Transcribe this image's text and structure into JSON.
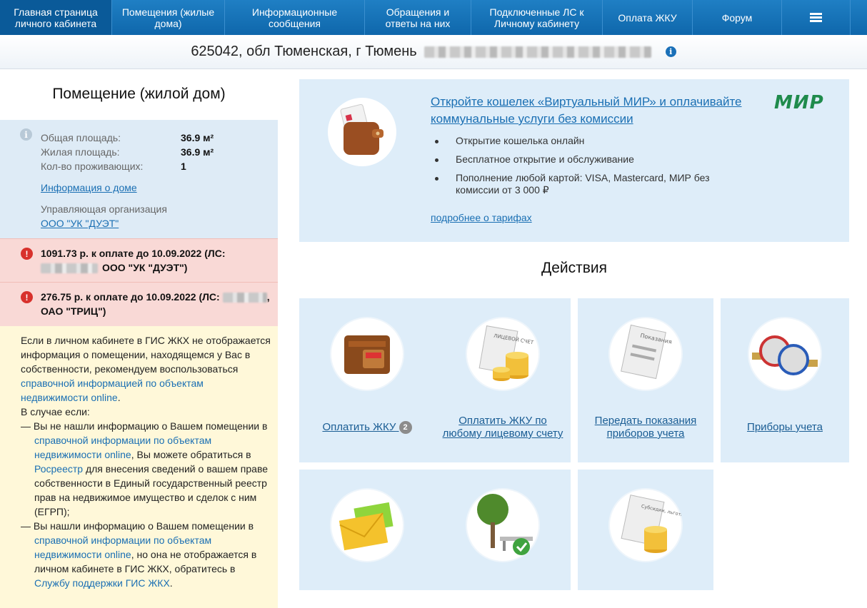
{
  "nav": {
    "items": [
      {
        "label": "Главная страница личного кабинета"
      },
      {
        "label": "Помещения (жилые дома)"
      },
      {
        "label": "Информационные сообщения"
      },
      {
        "label": "Обращения и ответы на них"
      },
      {
        "label": "Подключенные ЛС к Личному кабинету"
      },
      {
        "label": "Оплата ЖКУ"
      },
      {
        "label": "Форум"
      }
    ],
    "menu_icon": "hamburger-icon"
  },
  "address": {
    "text": "625042, обл Тюменская, г Тюмень"
  },
  "left": {
    "title": "Помещение (жилой дом)",
    "info": {
      "total_area_label": "Общая площадь:",
      "total_area_value": "36.9 м²",
      "living_area_label": "Жилая площадь:",
      "living_area_value": "36.9 м²",
      "residents_label": "Кол-во проживающих:",
      "residents_value": "1",
      "house_info_link": "Информация о доме",
      "management_label": "Управляющая организация",
      "management_link": "ООО \"УК \"ДУЭТ\""
    },
    "alerts": [
      {
        "line1": "1091.73 р. к оплате до 10.09.2022 (ЛС:",
        "line2": "ООО \"УК \"ДУЭТ\")"
      },
      {
        "line1": "276.75 р. к оплате до 10.09.2022 (ЛС:",
        "line2": "ОАО \"ТРИЦ\")"
      }
    ],
    "note": {
      "p1_a": "Если в личном кабинете в ГИС ЖКХ не отображается информация о помещении, находящемся у Вас в собственности, рекомендуем воспользоваться ",
      "p1_link": "справочной информацией по объектам недвижимости online",
      "p1_b": ".",
      "p2": "В случае если:",
      "d1_a": "— Вы не нашли информацию о Вашем помещении в ",
      "d1_link1": "справочной информации по объектам недвижимости online",
      "d1_b": ", Вы можете обратиться в ",
      "d1_link2": "Росреестр",
      "d1_c": " для внесения сведений о вашем праве собственности в Единый государственный реестр прав на недвижимое имущество и сделок с ним (ЕГРП);",
      "d2_a": "— Вы нашли информацию о Вашем помещении в ",
      "d2_link1": "справочной информации по объектам недвижимости online",
      "d2_b": ", но она не отображается в личном кабинете в ГИС ЖКХ, обратитесь в ",
      "d2_link2": "Службу поддержки ГИС ЖКХ",
      "d2_c": "."
    }
  },
  "promo": {
    "title": "Откройте кошелек «Виртуальный МИР» и оплачивайте коммунальные услуги без комиссии",
    "bullets": [
      "Открытие кошелька онлайн",
      "Бесплатное открытие и обслуживание",
      "Пополнение любой картой: VISA, Mastercard, МИР без комиссии от 3 000 ₽"
    ],
    "more_link": "подробнее о тарифах",
    "logo_text": "МИР"
  },
  "actions": {
    "title": "Действия",
    "tiles": [
      {
        "label": "Оплатить ЖКУ",
        "badge": "2",
        "icon": "wallet-icon"
      },
      {
        "label": "Оплатить ЖКУ по любому лицевому счету",
        "icon": "account-coins-icon",
        "paper_text": "ЛИЦЕВОЙ СЧЕТ"
      },
      {
        "label": "Передать показания приборов учета",
        "icon": "readings-paper-icon",
        "paper_text": "Показания"
      },
      {
        "label": "Приборы учета",
        "icon": "water-meters-icon"
      },
      {
        "label": "",
        "icon": "envelopes-icon"
      },
      {
        "label": "",
        "icon": "tree-bench-icon"
      },
      {
        "label": "",
        "icon": "subsidies-coins-icon",
        "paper_text": "Субсидии, льготы"
      }
    ]
  }
}
